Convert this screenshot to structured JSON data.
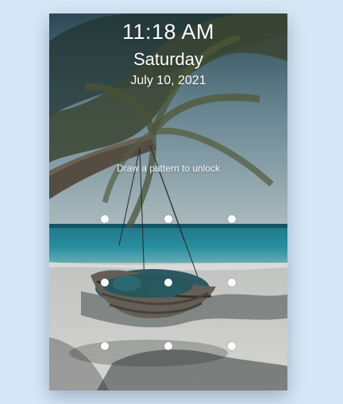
{
  "lock_screen": {
    "time": "11:18 AM",
    "day": "Saturday",
    "date": "July 10, 2021",
    "hint": "Draw a pattern to unlock"
  },
  "pattern_grid": {
    "rows": 3,
    "cols": 3
  },
  "colors": {
    "page_background": "#d6e8f7",
    "text": "#ffffff",
    "dot": "#ffffff"
  },
  "icons": [
    "pattern-dot"
  ]
}
